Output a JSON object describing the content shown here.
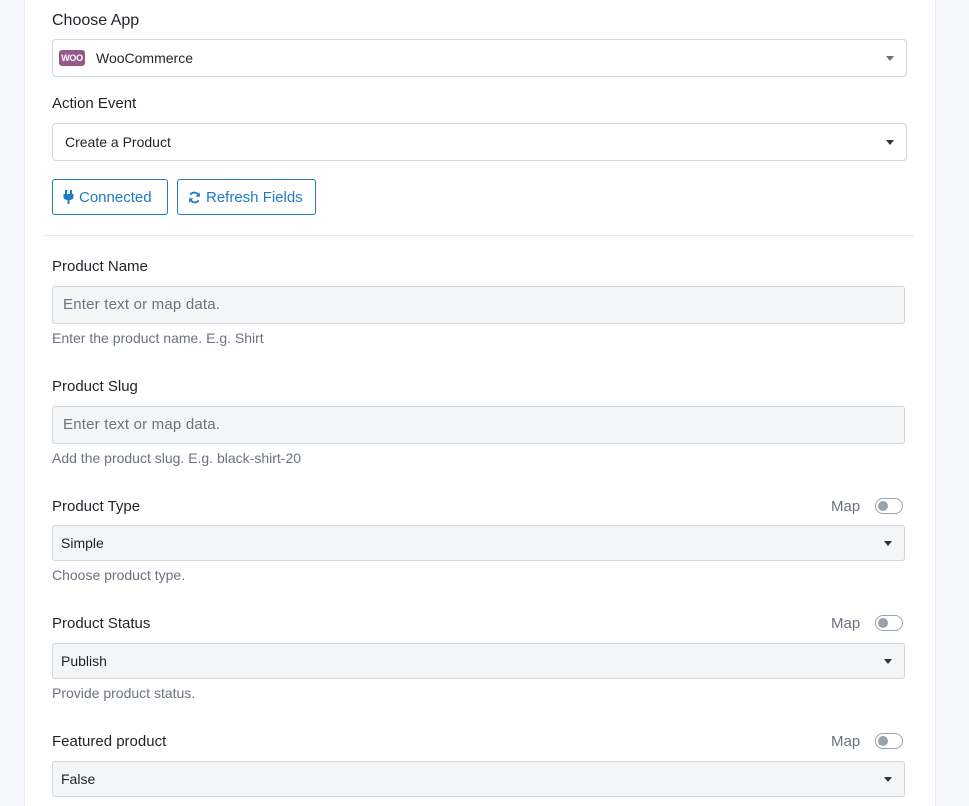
{
  "choose_app": {
    "label": "Choose App",
    "value": "WooCommerce",
    "logo_text": "WOO",
    "logo_icon": "woocommerce-logo",
    "brand_color": "#96588a"
  },
  "action_event": {
    "label": "Action Event",
    "value": "Create a Product"
  },
  "buttons": {
    "connected": {
      "label": "Connected",
      "icon": "plug-icon"
    },
    "refresh": {
      "label": "Refresh Fields",
      "icon": "refresh-icon"
    },
    "accent_color": "#1f7ac8"
  },
  "fields": {
    "product_name": {
      "label": "Product Name",
      "placeholder": "Enter text or map data.",
      "help": "Enter the product name. E.g. Shirt"
    },
    "product_slug": {
      "label": "Product Slug",
      "placeholder": "Enter text or map data.",
      "help": "Add the product slug. E.g. black-shirt-20"
    },
    "product_type": {
      "label": "Product Type",
      "map_label": "Map",
      "map_enabled": false,
      "value": "Simple",
      "help": "Choose product type."
    },
    "product_status": {
      "label": "Product Status",
      "map_label": "Map",
      "map_enabled": false,
      "value": "Publish",
      "help": "Provide product status."
    },
    "featured_product": {
      "label": "Featured product",
      "map_label": "Map",
      "map_enabled": false,
      "value": "False"
    }
  }
}
